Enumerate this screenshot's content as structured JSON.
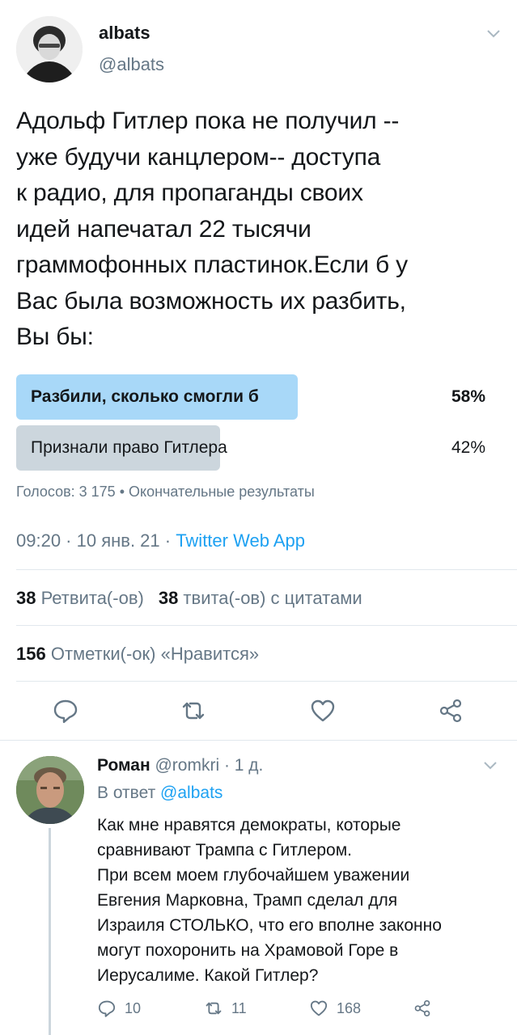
{
  "tweet": {
    "author_name": "albats",
    "author_handle": "@albats",
    "text": "Адольф Гитлер пока не получил --\nуже будучи канцлером-- доступа\nк радио, для пропаганды своих\nидей напечатал 22 тысячи\nграммофонных пластинок.Если б у\nВас была возможность их разбить,\nВы бы:",
    "poll": {
      "options": [
        {
          "label": "Разбили, сколько смогли б",
          "percent_text": "58%",
          "percent": 58,
          "winner": true
        },
        {
          "label": "Признали право Гитлера",
          "percent_text": "42%",
          "percent": 42,
          "winner": false
        }
      ],
      "meta": "Голосов: 3 175 • Окончательные результаты"
    },
    "time": "09:20 · 10 янв. 21 · ",
    "client": "Twitter Web App",
    "retweets_count": "38",
    "retweets_label": " Ретвита(-ов)",
    "quotes_count": "38",
    "quotes_label": " твита(-ов) с цитатами",
    "likes_count": "156",
    "likes_label": " Отметки(-ок) «Нравится»"
  },
  "reply": {
    "author_name": "Роман",
    "author_handle_time": " @romkri · 1 д.",
    "reply_prefix": "В ответ ",
    "reply_to": "@albats",
    "text": "Как мне нравятся демократы, которые\nсравнивают Трампа с Гитлером.\nПри всем моем глубочайшем уважении\nЕвгения Марковна, Трамп сделал для\nИзраиля СТОЛЬКО, что его вполне законно\nмогут похоронить на Храмовой Горе в\nИерусалиме. Какой Гитлер?",
    "reply_count": "10",
    "retweet_count": "11",
    "like_count": "168"
  },
  "icons": {
    "reply": "reply-icon",
    "retweet": "retweet-icon",
    "like": "heart-icon",
    "share": "share-icon",
    "caret": "chevron-down-icon"
  },
  "colors": {
    "accent": "#1da1f2",
    "poll_winner": "#a8d8f8",
    "poll_other": "#ccd6dd",
    "muted": "#657786"
  }
}
